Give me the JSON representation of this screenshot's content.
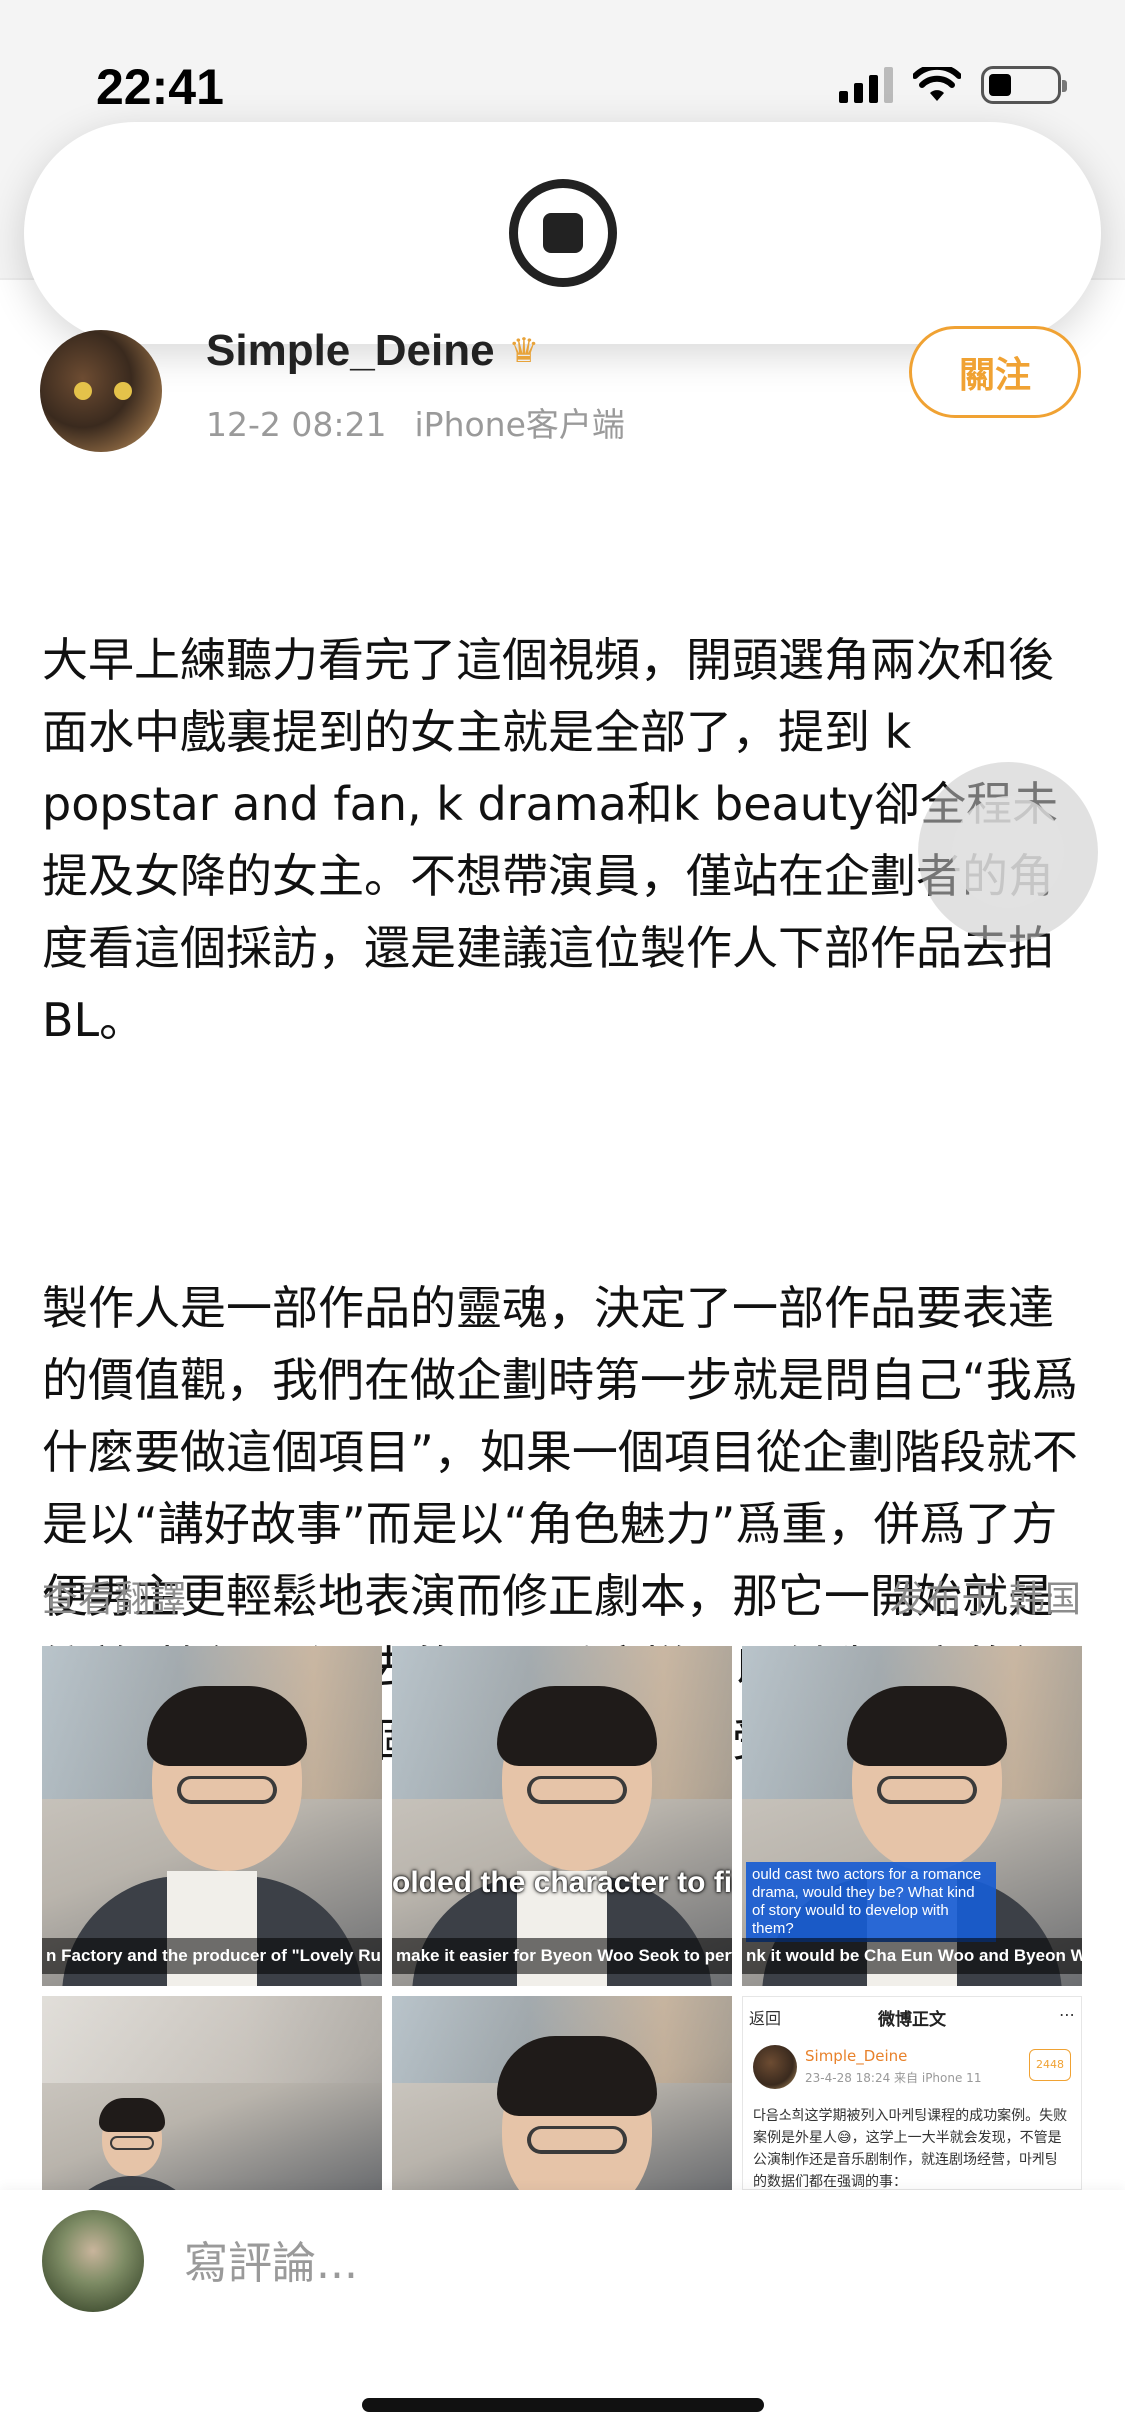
{
  "status_bar": {
    "time": "22:41",
    "icons": [
      "signal-icon",
      "wifi-icon",
      "battery-icon"
    ],
    "battery_level": 0.35
  },
  "recording": {
    "icon": "screen-record-stop-icon"
  },
  "post": {
    "author": "Simple_Deine",
    "author_badge_icon": "crown-icon",
    "timestamp": "12-2 08:21",
    "source": "iPhone客户端",
    "follow_label": "關注",
    "paragraphs": [
      "大早上練聽力看完了這個視頻，開頭選角兩次和後面水中戲裏提到的女主就是全部了，提到 k popstar and fan, k drama和k beauty卻全程未提及女降的女主。不想帶演員，僅站在企劃者的角度看這個採訪，還是建議這位製作人下部作品去拍BL。",
      "製作人是一部作品的靈魂，決定了一部作品要表達的價值觀，我們在做企劃時第一步就是問自己“我爲什麼要做這個項目”，如果一個項目從企劃階段就不是以“講好故事”而是以“角色魅力”爲重，併爲了方便男主更輕鬆地表演而修正劇本，那它一開始就是衝着“捧紅男主”去的，因爲這樣可以創造更高的經濟效益，不管這個人是誰，是最終受益者也是傀儡。"
    ],
    "translate_label": "查看翻譯",
    "location": "发布于 韩国"
  },
  "images": [
    {
      "subtitle_small": "n Factory and the producer of \"Lovely Runne"
    },
    {
      "subtitle_big": "olded the character to fi",
      "subtitle_small": "make it easier for Byeon Woo Seok to perfor"
    },
    {
      "quote": "ould cast two actors for a romance drama, would they be? What kind of story would to develop with them?",
      "subtitle_small": "nk it would be Cha Eun Woo and Byeon Woo S"
    },
    {},
    {},
    {
      "back_label": "返回",
      "title": "微博正文",
      "author": "Simple_Deine",
      "meta": "23-4-28 18:24 来自 iPhone 11",
      "badge": "2448",
      "text": "다음소희这学期被列入마케팅课程的成功案例。失败案例是外星人😅，这学上一大半就会发现，不管是公演制作还是音乐剧制作，就连剧场经营，마케팅的数据们都在强调的事："
    }
  ],
  "comment": {
    "placeholder": "寫評論..."
  }
}
